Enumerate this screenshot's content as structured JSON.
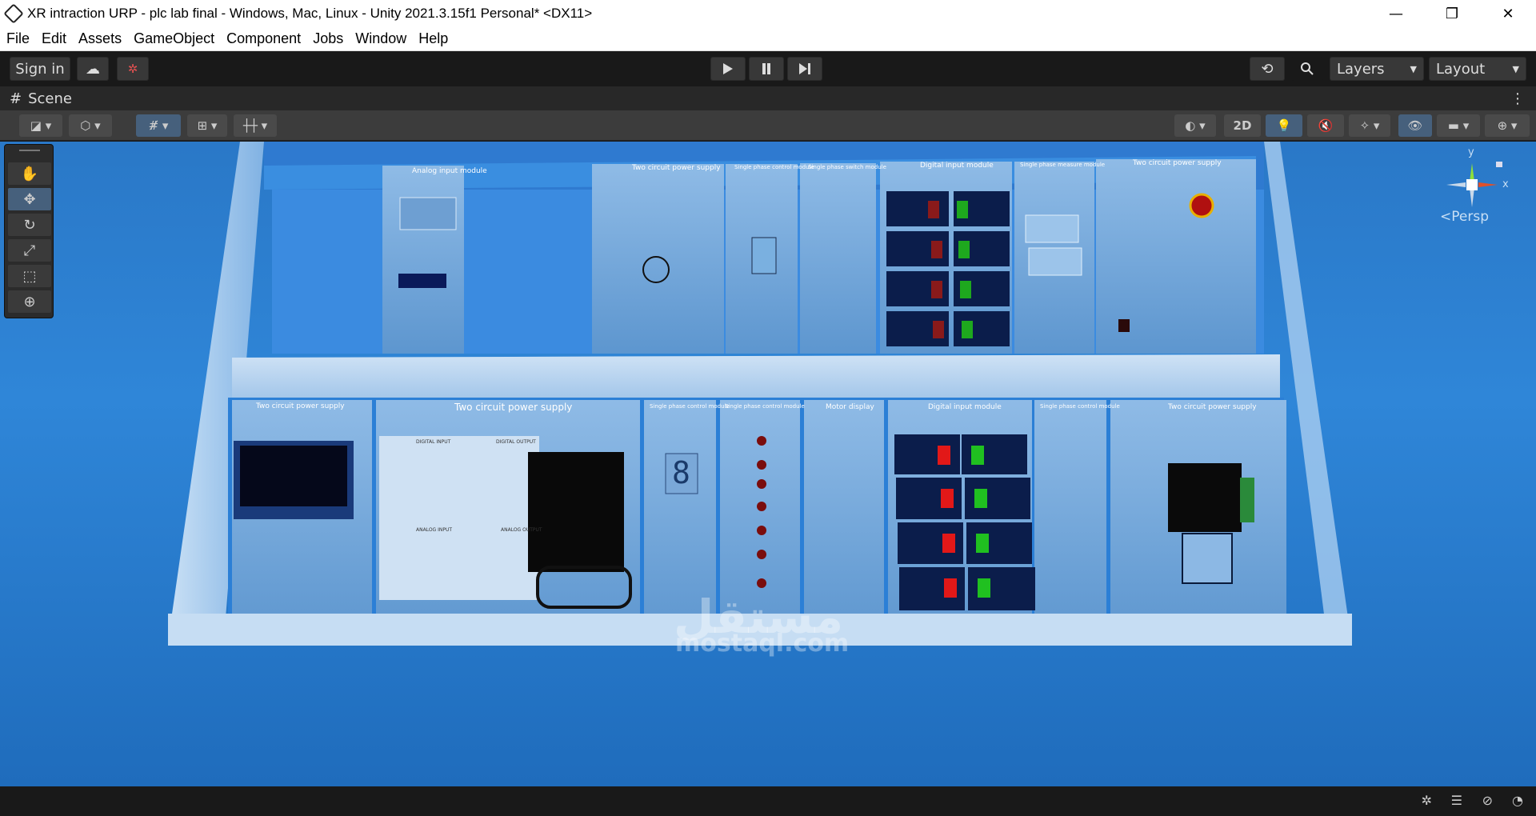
{
  "window": {
    "title": "XR intraction URP - plc lab final - Windows, Mac, Linux - Unity 2021.3.15f1 Personal* <DX11>",
    "minimize": "—",
    "restore": "❐",
    "close": "✕"
  },
  "menu": [
    "File",
    "Edit",
    "Assets",
    "GameObject",
    "Component",
    "Jobs",
    "Window",
    "Help"
  ],
  "toolbar": {
    "sign_in": "Sign in",
    "layers": "Layers",
    "layout": "Layout"
  },
  "scene_tab": {
    "label": "Scene"
  },
  "scene_bar": {
    "mode_2d": "2D"
  },
  "gizmo": {
    "y": "y",
    "x": "x",
    "persp": "Persp"
  },
  "modules": {
    "top": [
      "Analog input module",
      "Two circuit power supply",
      "Single phase control module",
      "Single phase switch module",
      "Digital input module",
      "Single phase measure module",
      "Two circuit power supply"
    ],
    "bottom": [
      "Two circuit power supply",
      "Two circuit power supply",
      "Single phase control module",
      "Single phase control module",
      "Motor display",
      "Digital input module",
      "Single phase control module",
      "Two circuit power supply"
    ],
    "plc_labels": [
      "DIGITAL INPUT",
      "DIGITAL OUTPUT",
      "ANALOG INPUT",
      "ANALOG OUTPUT"
    ],
    "seven_segment": "8"
  },
  "watermark": {
    "arabic": "مستقل",
    "latin": "mostaql.com"
  }
}
